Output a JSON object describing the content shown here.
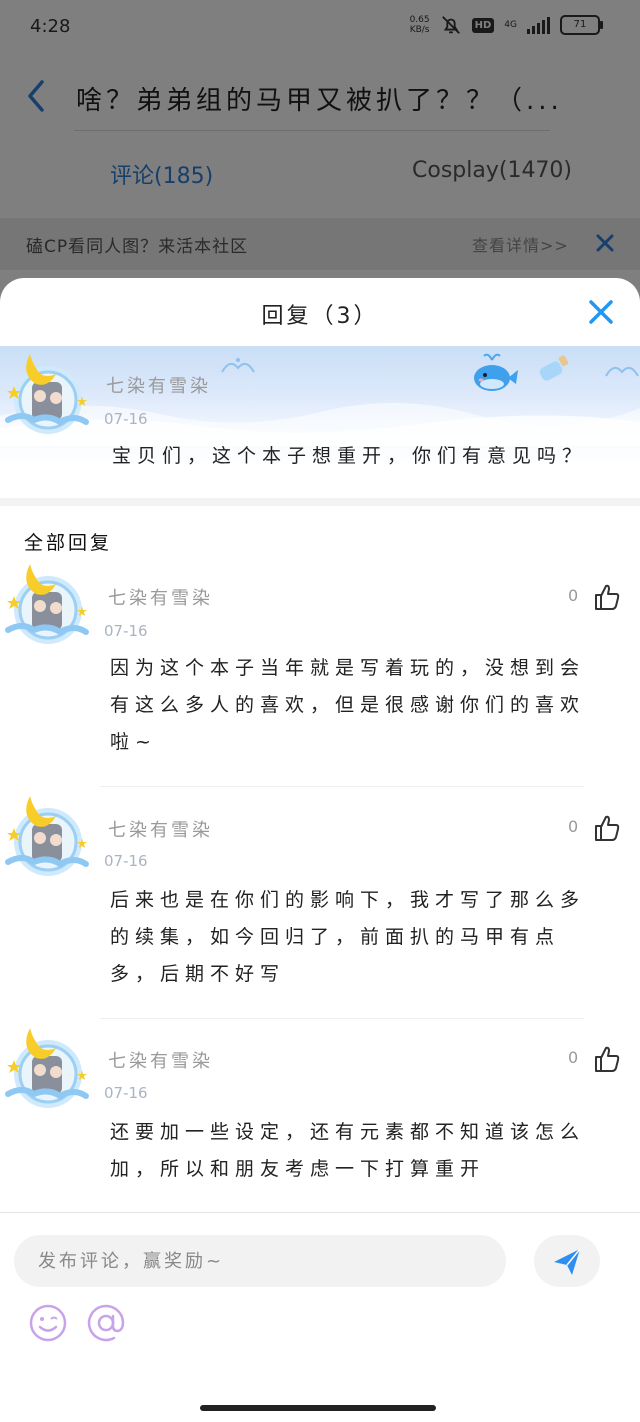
{
  "status_bar": {
    "time": "4:28",
    "net_speed_value": "0.65",
    "net_speed_unit": "KB/s",
    "hd": "HD",
    "network": "4G",
    "battery": "71"
  },
  "nav": {
    "title": "啥？弟弟组的马甲又被扒了？？（..."
  },
  "tabs": [
    {
      "label": "评论(185)"
    },
    {
      "label": "Cosplay(1470)"
    }
  ],
  "banner": {
    "text": "磕CP看同人图？来活本社区",
    "link": "查看详情>>"
  },
  "sheet": {
    "title": "回复（3）"
  },
  "parent_comment": {
    "username": "七染有雪染",
    "date": "07-16",
    "content": "宝贝们，这个本子想重开，你们有意见吗？"
  },
  "all_replies_label": "全部回复",
  "replies": [
    {
      "username": "七染有雪染",
      "date": "07-16",
      "likes": "0",
      "content_lines": [
        "因为这个本子当年就是写着玩的，没想到会",
        "有这么多人的喜欢，但是很感谢你们的喜欢",
        "啦~"
      ]
    },
    {
      "username": "七染有雪染",
      "date": "07-16",
      "likes": "0",
      "content_lines": [
        "后来也是在你们的影响下，我才写了那么多",
        "的续集，如今回归了，前面扒的马甲有点",
        "多，后期不好写"
      ]
    },
    {
      "username": "七染有雪染",
      "date": "07-16",
      "likes": "0",
      "content_lines": [
        "还要加一些设定，还有元素都不知道该怎么",
        "加，所以和朋友考虑一下打算重开"
      ]
    }
  ],
  "composer": {
    "placeholder": "发布评论，赢奖励~"
  },
  "colors": {
    "accent": "#2f7fd8",
    "close_blue": "#2196f3",
    "emoji_purple": "#c9a3ea"
  }
}
